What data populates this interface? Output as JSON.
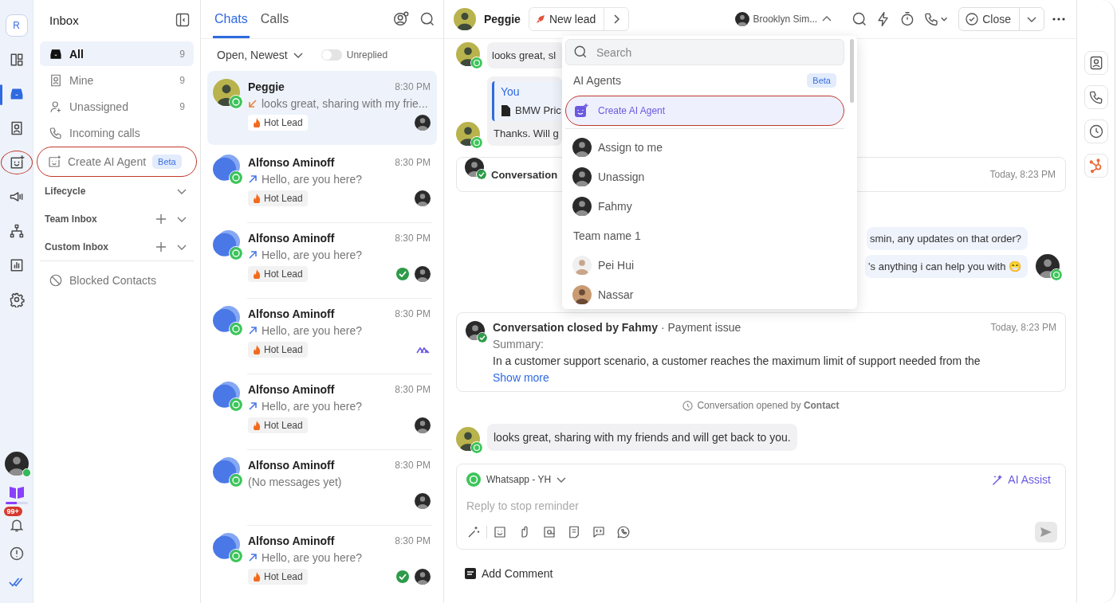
{
  "rail": {
    "workspace": "R",
    "items": [
      {
        "selected": false,
        "annotated": false
      },
      {
        "selected": true,
        "annotated": false
      },
      {
        "selected": false,
        "annotated": false
      },
      {
        "selected": false,
        "annotated": true
      },
      {
        "selected": false,
        "annotated": false
      },
      {
        "selected": false,
        "annotated": false
      },
      {
        "selected": false,
        "annotated": false
      },
      {
        "selected": false,
        "annotated": false
      }
    ],
    "user": {
      "online": true
    },
    "guide": {
      "level": 0.5
    },
    "notifications": "99+"
  },
  "sidebar": {
    "title": "Inbox",
    "items": [
      {
        "label": "All",
        "count": "9",
        "selected": true,
        "annotated": false
      },
      {
        "label": "Mine",
        "count": "9",
        "selected": false,
        "annotated": false
      },
      {
        "label": "Unassigned",
        "count": "9",
        "selected": false,
        "annotated": false
      },
      {
        "label": "Incoming calls",
        "selected": false,
        "annotated": false
      },
      {
        "label": "Create AI Agent",
        "badge": "Beta",
        "selected": false,
        "annotated": true
      }
    ],
    "sections": [
      {
        "label": "Lifecycle",
        "addable": false
      },
      {
        "label": "Team Inbox",
        "addable": true
      },
      {
        "label": "Custom Inbox",
        "addable": true
      }
    ],
    "footer": "Blocked Contacts"
  },
  "chat_list": {
    "tabs": [
      {
        "label": "Chats",
        "selected": true
      },
      {
        "label": "Calls",
        "selected": false
      }
    ],
    "filter": "Open, Newest",
    "toggle": {
      "label": "Unreplied",
      "on": false
    },
    "chats": [
      {
        "name": "Peggie",
        "time": "8:30 PM",
        "kind": "incoming",
        "preview": "looks great, sharing with my frie...",
        "tag": "Hot Lead",
        "photo": true,
        "bot": false,
        "resolved": false,
        "selected": true
      },
      {
        "name": "Alfonso Aminoff",
        "time": "8:30 PM",
        "kind": "outgoing",
        "preview": "Hello, are you here?",
        "tag": "Hot Lead",
        "photo": false,
        "bot": false,
        "resolved": false,
        "selected": false
      },
      {
        "name": "Alfonso Aminoff",
        "time": "8:30 PM",
        "kind": "outgoing",
        "preview": "Hello, are you here?",
        "tag": "Hot Lead",
        "photo": false,
        "bot": false,
        "resolved": true,
        "selected": false
      },
      {
        "name": "Alfonso Aminoff",
        "time": "8:30 PM",
        "kind": "outgoing",
        "preview": "Hello, are you here?",
        "tag": "Hot Lead",
        "photo": false,
        "bot": true,
        "resolved": false,
        "selected": false
      },
      {
        "name": "Alfonso Aminoff",
        "time": "8:30 PM",
        "kind": "outgoing",
        "preview": "Hello, are you here?",
        "tag": "Hot Lead",
        "photo": false,
        "bot": false,
        "resolved": false,
        "selected": false
      },
      {
        "name": "Alfonso Aminoff",
        "time": "8:30 PM",
        "kind": "empty",
        "preview": "(No messages yet)",
        "photo": false,
        "bot": false,
        "resolved": false,
        "selected": false
      },
      {
        "name": "Alfonso Aminoff",
        "time": "8:30 PM",
        "kind": "outgoing",
        "preview": "Hello, are you here?",
        "tag": "Hot Lead",
        "photo": false,
        "bot": false,
        "resolved": true,
        "selected": false
      }
    ]
  },
  "conversation": {
    "contact": "Peggie",
    "stage": "New lead",
    "assignee": "Brooklyn Sim...",
    "close": "Close",
    "messages": [
      {
        "kind": "incoming",
        "text": "looks great, sl"
      },
      {
        "kind": "reply",
        "quote_author": "You",
        "quote_text": "BMW Pric",
        "text": "Thanks. Will g"
      },
      {
        "kind": "event",
        "title": "Conversation",
        "time": "Today, 8:23 PM"
      },
      {
        "kind": "outgoing",
        "lines": [
          "smin, any updates on that order?",
          "'s anything i can help you with 😁"
        ]
      },
      {
        "kind": "summary",
        "title": "Conversation closed by Fahmy",
        "topic": "· Payment issue",
        "time": "Today, 8:23 PM",
        "label": "Summary:",
        "text": "In a customer support scenario, a customer reaches the maximum limit of support needed from the",
        "link": "Show more"
      },
      {
        "kind": "system",
        "text": "Conversation opened by **Contact**"
      },
      {
        "kind": "incoming",
        "text": "looks great, sharing with my friends and will get back to you."
      }
    ],
    "composer": {
      "channel": "Whatsapp - YH",
      "ai": "AI Assist",
      "placeholder": "Reply to stop reminder",
      "comment": "Add Comment"
    }
  },
  "assign_menu": {
    "search": {
      "placeholder": "Search"
    },
    "section": "AI Agents",
    "badge": "Beta",
    "create": {
      "label": "Create AI Agent",
      "annotated": true
    },
    "options": [
      {
        "label": "Assign to me"
      },
      {
        "label": "Unassign"
      },
      {
        "label": "Fahmy"
      }
    ],
    "team": "Team name 1",
    "members": [
      {
        "label": "Pei Hui"
      },
      {
        "label": "Nassar"
      }
    ]
  }
}
